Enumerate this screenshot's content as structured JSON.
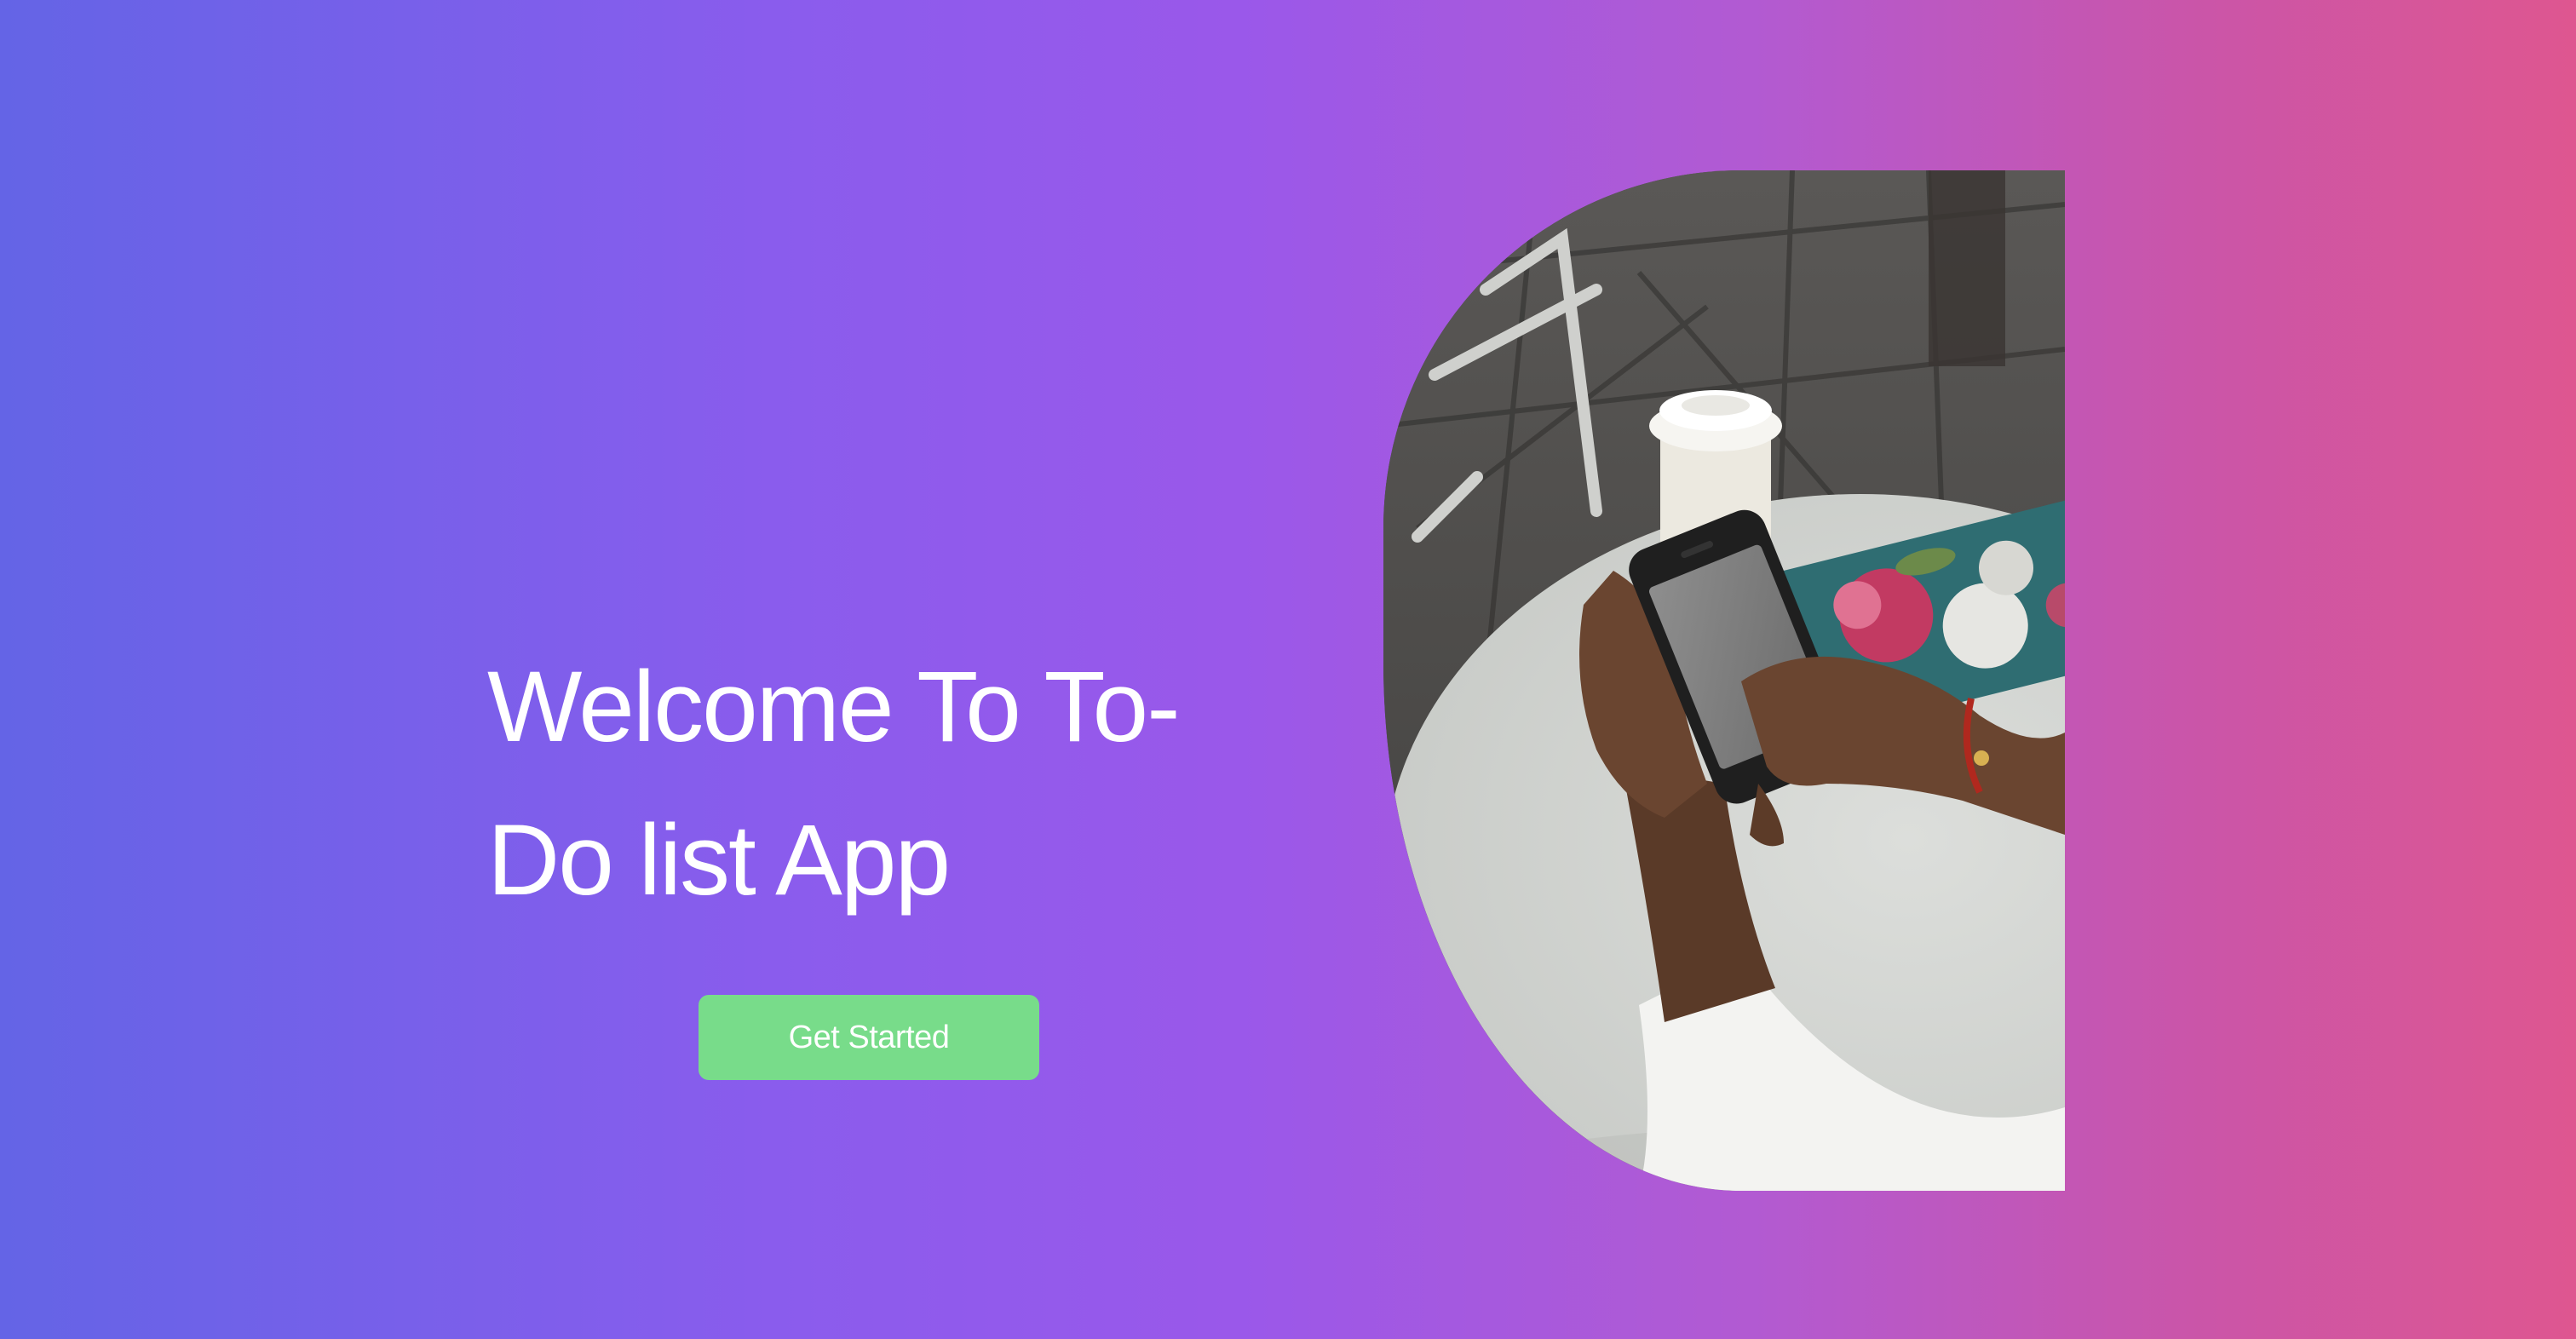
{
  "hero": {
    "title": "Welcome To To-Do list App",
    "cta_label": "Get Started",
    "photo": {
      "subject": "hands-holding-phone-at-cafe-table"
    }
  },
  "colors": {
    "gradient_start": "#6464e6",
    "gradient_mid": "#9a58ea",
    "gradient_end": "#de5690",
    "cta_background": "#78dc8a",
    "text": "#ffffff"
  }
}
